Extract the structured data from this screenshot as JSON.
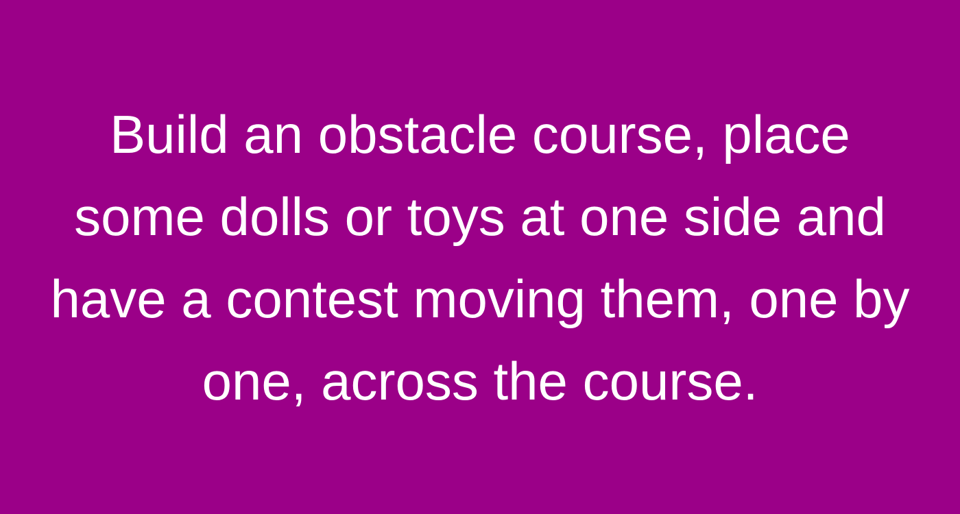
{
  "colors": {
    "background": "#9b0088",
    "text": "#ffffff"
  },
  "message": {
    "lines": [
      "Build an obstacle course, place",
      "some dolls or toys at one side and",
      "have a contest moving them, one by",
      "one, across the course."
    ]
  }
}
